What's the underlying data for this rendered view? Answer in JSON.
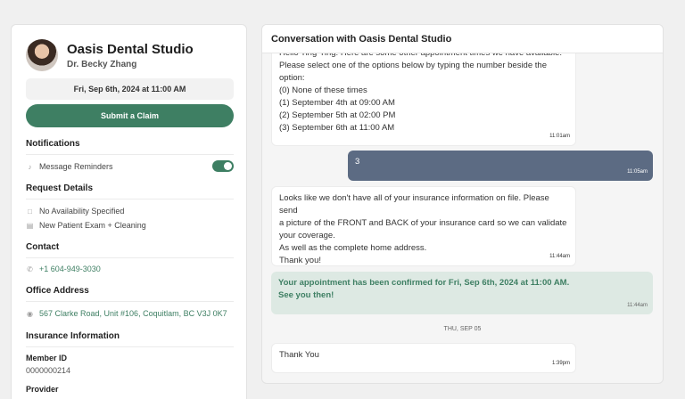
{
  "profile": {
    "clinic": "Oasis Dental Studio",
    "doctor": "Dr. Becky Zhang"
  },
  "appointment_date": "Fri, Sep 6th, 2024 at 11:00 AM",
  "claim_button": "Submit a Claim",
  "notifications": {
    "title": "Notifications",
    "reminders_label": "Message Reminders",
    "reminders_on": true
  },
  "request": {
    "title": "Request Details",
    "availability": "No Availability Specified",
    "service": "New Patient Exam + Cleaning"
  },
  "contact": {
    "title": "Contact",
    "phone": "+1 604-949-3030"
  },
  "office": {
    "title": "Office Address",
    "address": "567 Clarke Road, Unit #106, Coquitlam, BC V3J 0K7"
  },
  "insurance": {
    "title": "Insurance Information",
    "member_id_label": "Member ID",
    "member_id": "0000000214",
    "provider_label": "Provider"
  },
  "conversation": {
    "title": "Conversation with Oasis Dental Studio",
    "m1": {
      "l0": "Hello Ting-Ting. Here are some other appointment times we have available.",
      "l1": "Please select one of the options below by typing the number beside the",
      "l2": "option:",
      "l3": "(0) None of these times",
      "l4": "(1) September 4th at 09:00 AM",
      "l5": "(2) September 5th at 02:00 PM",
      "l6": "(3) September 6th at 11:00 AM",
      "time": "11:01am"
    },
    "m2": {
      "text": "3",
      "time": "11:05am"
    },
    "m3": {
      "l0": "Looks like we don't have all of your insurance information on file. Please send",
      "l1": "a picture of the FRONT and BACK of your insurance card so we can validate",
      "l2": "your coverage.",
      "l3": "As well as the complete home address.",
      "l4": "Thank you!",
      "time": "11:44am"
    },
    "m4": {
      "l0": "Your appointment has been confirmed for Fri, Sep 6th, 2024 at 11:00 AM.",
      "l1": "See you then!",
      "time": "11:44am"
    },
    "day_separator": "THU, SEP 05",
    "m5": {
      "text": "Thank You",
      "time": "1:39pm"
    }
  },
  "colors": {
    "accent": "#3e7f63",
    "outgoing": "#5c6b83",
    "system_bg": "#dde9e3"
  }
}
